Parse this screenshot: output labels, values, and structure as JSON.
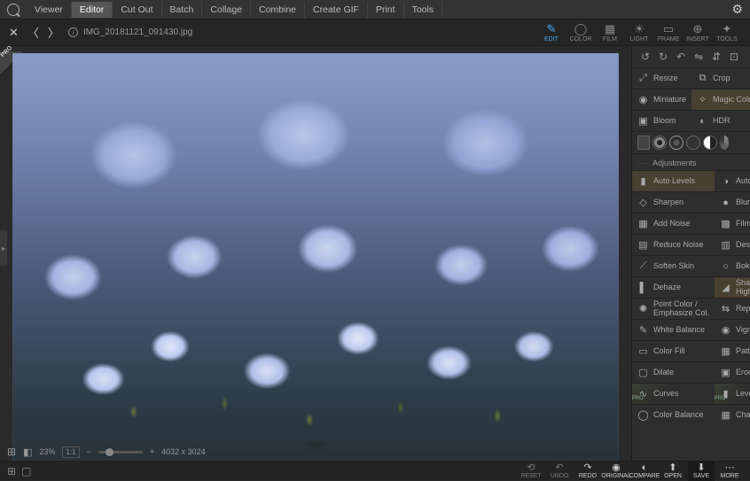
{
  "menubar": {
    "items": [
      "Viewer",
      "Editor",
      "Cut Out",
      "Batch",
      "Collage",
      "Combine",
      "Create GIF",
      "Print",
      "Tools"
    ],
    "activeIndex": 1
  },
  "file": {
    "name": "IMG_20181121_091430.jpg",
    "dimensions": "4032 x 3024",
    "zoom": "23%"
  },
  "modeTabs": [
    {
      "label": "EDIT",
      "icon": "✎"
    },
    {
      "label": "COLOR",
      "icon": "◯"
    },
    {
      "label": "FILM",
      "icon": "▦"
    },
    {
      "label": "LIGHT",
      "icon": "☀"
    },
    {
      "label": "FRAME",
      "icon": "▭"
    },
    {
      "label": "INSERT",
      "icon": "⊕"
    },
    {
      "label": "TOOLS",
      "icon": "✦"
    }
  ],
  "modeActive": 0,
  "quickTools": [
    "↺",
    "↻",
    "↶",
    "⇋",
    "⇵",
    "⊡"
  ],
  "topTools": [
    {
      "label": "Resize",
      "icon": "⤢"
    },
    {
      "label": "Crop",
      "icon": "⧉"
    },
    {
      "label": "Miniature",
      "icon": "◉"
    },
    {
      "label": "Magic Color",
      "icon": "✧",
      "active": true
    },
    {
      "label": "Bloom",
      "icon": "▣"
    },
    {
      "label": "HDR",
      "icon": "◐"
    }
  ],
  "adjustHeader": "Adjustments",
  "adjustments": [
    {
      "label": "Auto Levels",
      "icon": "▮",
      "active": true
    },
    {
      "label": "Auto Contrast",
      "icon": "◑"
    },
    {
      "label": "Sharpen",
      "icon": "◇"
    },
    {
      "label": "Blur",
      "icon": "●"
    },
    {
      "label": "Add Noise",
      "icon": "▦"
    },
    {
      "label": "Film Grain",
      "icon": "▩"
    },
    {
      "label": "Reduce Noise",
      "icon": "▤"
    },
    {
      "label": "Despeckle",
      "icon": "▥"
    },
    {
      "label": "Soften Skin",
      "icon": "⟋"
    },
    {
      "label": "Bokeh Blur",
      "icon": "○"
    },
    {
      "label": "Dehaze",
      "icon": "▌"
    },
    {
      "label": "Shadows/\nHighlights",
      "icon": "◢",
      "active": true
    },
    {
      "label": "Point Color /\nEmphasize Col.",
      "icon": "✺"
    },
    {
      "label": "Replace Color",
      "icon": "⇆"
    },
    {
      "label": "White Balance",
      "icon": "✎"
    },
    {
      "label": "Vignette",
      "icon": "◉"
    },
    {
      "label": "Color Fill",
      "icon": "▭"
    },
    {
      "label": "Pattern Fill",
      "icon": "▦"
    },
    {
      "label": "Dilate",
      "icon": "▢"
    },
    {
      "label": "Erode",
      "icon": "▣"
    },
    {
      "label": "Curves",
      "icon": "∿",
      "pro": true
    },
    {
      "label": "Levels",
      "icon": "▮",
      "pro": true
    },
    {
      "label": "Color Balance",
      "icon": "◯"
    },
    {
      "label": "Channel Mixer",
      "icon": "▦"
    }
  ],
  "bottomActions": [
    {
      "label": "RESET",
      "icon": "⟲"
    },
    {
      "label": "UNDO",
      "icon": "↶"
    },
    {
      "label": "REDO",
      "icon": "↷"
    },
    {
      "label": "ORIGINAL",
      "icon": "◉"
    },
    {
      "label": "COMPARE",
      "icon": "◐"
    },
    {
      "label": "OPEN",
      "icon": "⬆"
    },
    {
      "label": "SAVE",
      "icon": "⬇"
    },
    {
      "label": "MORE",
      "icon": "⋯"
    }
  ],
  "proBadge": "PRO",
  "fit": "1:1"
}
